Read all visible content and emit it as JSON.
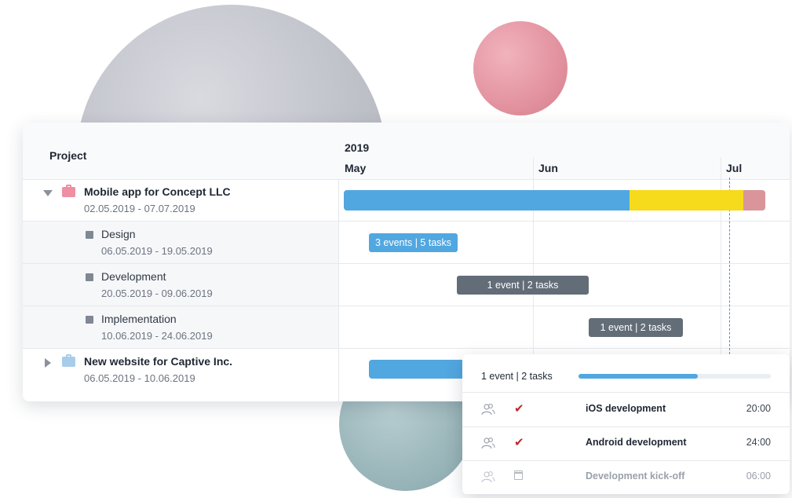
{
  "colors": {
    "accent_blue": "#51a7e0",
    "accent_yellow": "#f6da1c",
    "accent_pink": "#d9959a",
    "pill_gray": "#626d78",
    "check_red": "#c0272d"
  },
  "project_list": {
    "header": "Project",
    "rows": [
      {
        "title": "Mobile app for Concept LLC",
        "dates": "02.05.2019 - 07.07.2019",
        "icon": "folder-icon",
        "expanded": true
      },
      {
        "title": "Design",
        "dates": "06.05.2019 - 19.05.2019",
        "icon": "square-icon"
      },
      {
        "title": "Development",
        "dates": "20.05.2019 - 09.06.2019",
        "icon": "square-icon"
      },
      {
        "title": "Implementation",
        "dates": "10.06.2019 - 24.06.2019",
        "icon": "square-icon"
      },
      {
        "title": "New website for Captive Inc.",
        "dates": "06.05.2019 - 10.06.2019",
        "icon": "folder-icon",
        "expanded": false
      }
    ]
  },
  "timeline": {
    "year": "2019",
    "months": [
      "May",
      "Jun",
      "Jul"
    ],
    "bars": {
      "design_label": "3 events | 5 tasks",
      "development_label": "1 event | 2 tasks",
      "implementation_label": "1 event | 2 tasks"
    }
  },
  "popup": {
    "summary": "1 event | 2 tasks",
    "progress": 0.62,
    "tasks": [
      {
        "name": "iOS development",
        "time": "20:00",
        "status_icon": "check-icon"
      },
      {
        "name": "Android development",
        "time": "24:00",
        "status_icon": "check-icon"
      },
      {
        "name": "Development kick-off",
        "time": "06:00",
        "status_icon": "calendar-icon"
      }
    ],
    "icons": {
      "check": "✔"
    }
  }
}
